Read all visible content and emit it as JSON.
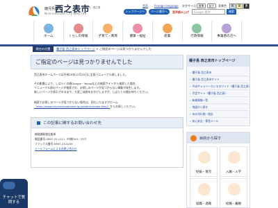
{
  "header": {
    "pref": "鹿児島県",
    "city": "西之表市",
    "tagline": "だいすき、西之表",
    "subtitle": "Nishinoomote City Web site",
    "link_voice": "音声",
    "link_foreign": "Foreign language",
    "size_label": "文字サイズ",
    "size_standard": "標準",
    "size_large": "拡大",
    "color_label": "背景色",
    "btn_top": "トップページへ",
    "btn_page": "ページ番号へ",
    "search_label": "音声読み上げ",
    "search_placeholder": "Google 提供",
    "search_btn": "検索",
    "color_options": [
      "青",
      "黄",
      "黒"
    ]
  },
  "nav": [
    {
      "label": "ホーム",
      "color": "#7cb3e0"
    },
    {
      "label": "くらしの情報",
      "color": "#e58b8b"
    },
    {
      "label": "子育て・教育",
      "color": "#f4b26b"
    },
    {
      "label": "健康・福祉",
      "color": "#f08fa8"
    },
    {
      "label": "産業",
      "color": "#f5a55a"
    },
    {
      "label": "行政情報",
      "color": "#8bc6a0"
    },
    {
      "label": "事業者の方へ",
      "color": "#b8a2d8"
    }
  ],
  "breadcrumb": {
    "tag": "現在の位置",
    "home": "種子島 西之表市トップページ",
    "sep": " > ",
    "current": "ご指定のページは見つかりませんでした"
  },
  "main": {
    "title": "ご指定のページは見つかりませんでした",
    "p1": "西之表市ホームページは平成29年12月25日に全面リニューアル致しました。",
    "p2": [
      "その影響により、しばらくの間Google・Yahooなどの検索サイトから検索した場合、",
      "リニューアル前のページが検索され、お探しのページが見つからない事象が発生します。",
      "新しいページが表示されるまで、大変ご迷惑をおかけしますが、しばらくの間お待ちください。"
    ],
    "p3a": "検索でお探しのページが見つからない場合は、恐れいりますがホーム",
    "p3_link": "（http://www.city.nishinoomote.lg.jp/admin/index.html）",
    "p3b": "からお探しください。"
  },
  "contact": {
    "heading": "この記事に関するお問い合わせ先",
    "dept": "総務課秘書広報係",
    "tel": "電話番号:0997-22-1111（内線253・257）",
    "fax": "ファックス番号:0997-23-0205",
    "mail": "メールフォームによるお問い合わせ"
  },
  "sidebar": {
    "heading": "種子島 西之表市トップページ",
    "items": [
      "種子島 西之表市",
      "種子島 西之表市サイト",
      "平成ギャラリーだいすきワイド（種子島 西之表）",
      "手話サイト（種子島 西之表）",
      "新着情報一覧",
      "地図から探す",
      "市の刊行物・統計",
      "安心安全・緊急メール"
    ]
  },
  "goals": {
    "heading": "目的から探す",
    "items": [
      "妊娠・育児",
      "入園・入学",
      "就職・退職",
      "結婚・離婚"
    ]
  },
  "chat": {
    "label": "チャットで質問する"
  }
}
